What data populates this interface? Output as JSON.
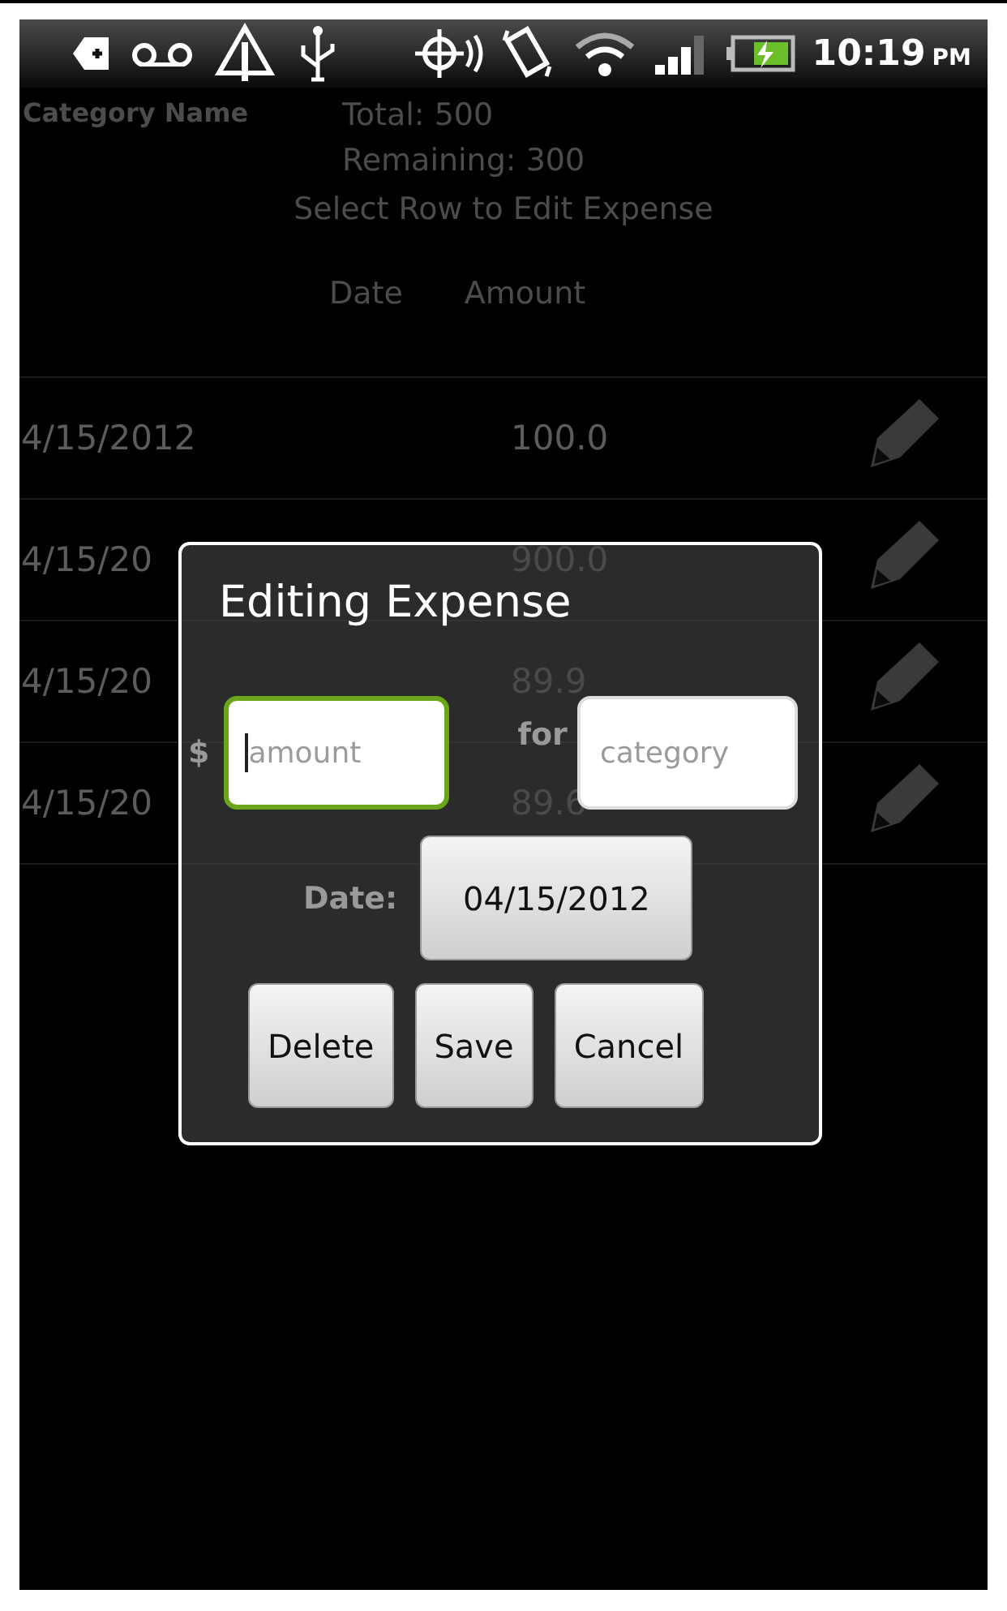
{
  "status_bar": {
    "time": "10:19",
    "meridiem": "PM"
  },
  "header": {
    "category": "Category Name",
    "total": "Total: 500",
    "remaining": "Remaining: 300",
    "hint": "Select Row to Edit Expense"
  },
  "table": {
    "columns": [
      "Date",
      "Amount"
    ],
    "rows": [
      {
        "date": "4/15/2012",
        "amount": "100.0"
      },
      {
        "date": "4/15/20",
        "amount": "900.0"
      },
      {
        "date": "4/15/20",
        "amount": "89.9"
      },
      {
        "date": "4/15/20",
        "amount": "89.6"
      }
    ]
  },
  "dialog": {
    "title": "Editing Expense",
    "currency": "$",
    "amount": {
      "placeholder": "amount",
      "focused": true
    },
    "for_label": "for",
    "category": {
      "placeholder": "category",
      "focused": false
    },
    "date_label": "Date:",
    "date": "04/15/2012",
    "buttons": [
      "Delete",
      "Save",
      "Cancel"
    ]
  }
}
